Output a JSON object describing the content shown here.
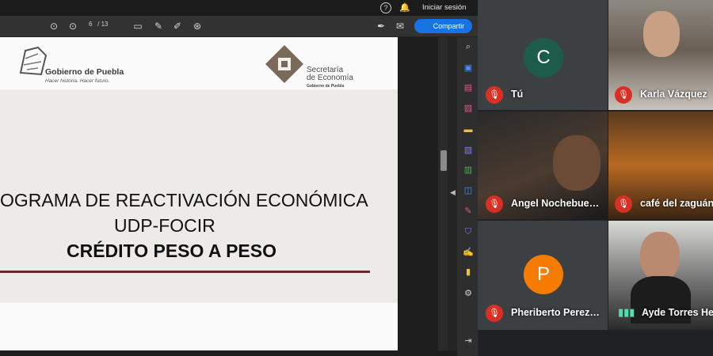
{
  "topbar": {
    "help_glyph": "?",
    "bell_glyph": "🔔",
    "signin": "Iniciar sesión"
  },
  "toolbar": {
    "page_current": "6",
    "page_total": "/ 13",
    "share": "Compartir"
  },
  "document": {
    "header_left_title": "Gobierno de Puebla",
    "header_left_sub": "Hacer historia. Hacer futuro.",
    "header_right_line1": "Secretaría",
    "header_right_line2": "de Economía",
    "header_right_sub": "Gobierno de Puebla",
    "title_line1": "OGRAMA DE REACTIVACIÓN ECONÓMICA",
    "title_line2": "UDP-FOCIR",
    "title_line3": "CRÉDITO PESO A PESO"
  },
  "participants": [
    {
      "name": "Tú",
      "initial": "C",
      "muted": true,
      "avatar_color": "#1e5c4a"
    },
    {
      "name": "Karla Vázquez",
      "muted": true
    },
    {
      "name": "Angel Nochebue…",
      "muted": true
    },
    {
      "name": "café del zaguán",
      "muted": true
    },
    {
      "name": "Pheriberto Perez…",
      "initial": "P",
      "muted": true,
      "avatar_color": "#f57c00"
    },
    {
      "name": "Ayde Torres He",
      "muted": false
    }
  ]
}
